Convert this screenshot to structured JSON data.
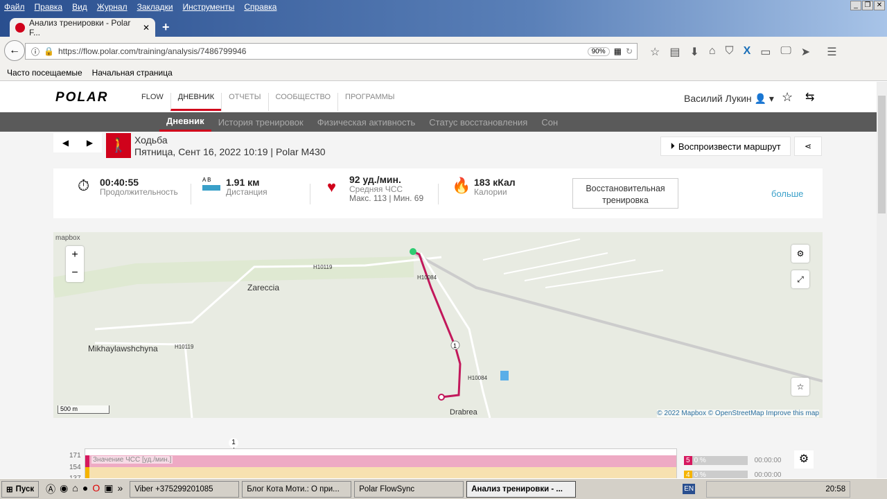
{
  "browser": {
    "menu": [
      "Файл",
      "Правка",
      "Вид",
      "Журнал",
      "Закладки",
      "Инструменты",
      "Справка"
    ],
    "tab_title": "Анализ тренировки - Polar F...",
    "url": "https://flow.polar.com/training/analysis/7486799946",
    "zoom": "90%",
    "bookmarks": [
      "Часто посещаемые",
      "Начальная страница"
    ]
  },
  "header": {
    "logo": "POLAR",
    "nav": [
      "FLOW",
      "ДНЕВНИК",
      "ОТЧЕТЫ",
      "СООБЩЕСТВО",
      "ПРОГРАММЫ"
    ],
    "user": "Василий Лукин"
  },
  "subnav": [
    "Дневник",
    "История тренировок",
    "Физическая активность",
    "Статус восстановления",
    "Сон"
  ],
  "session": {
    "sport": "Ходьба",
    "date": "Пятница, Сент 16, 2022 10:19 | Polar M430",
    "replay": "Воспроизвести маршрут"
  },
  "summary": {
    "duration": "00:40:55",
    "duration_label": "Продолжительность",
    "ab": "A   B",
    "distance": "1.91 км",
    "distance_label": "Дистанция",
    "hr": "92 уд./мин.",
    "hr_label": "Средняя ЧСС",
    "hr_minmax": "Макс. 113  |  Мин. 69",
    "calories": "183 кКал",
    "calories_label": "Калории",
    "benefit": "Восстановительная тренировка",
    "more": "больше"
  },
  "map": {
    "brand": "mapbox",
    "labels": [
      "Zareccia",
      "Mikhaylawshchyna",
      "H10119",
      "H10119",
      "H10084",
      "H10084",
      "Drabrea"
    ],
    "scale": "500 m",
    "attribution": "© 2022 Mapbox © OpenStreetMap Improve this map",
    "zoom_in": "+",
    "zoom_out": "−",
    "marker": "1"
  },
  "chart": {
    "yticks": [
      "171",
      "154",
      "137"
    ],
    "series_label": "Значение ЧСС [уд./мин.]",
    "marker": "1",
    "zones": [
      {
        "zone": "5",
        "pct": "0 %",
        "time": "00:00:00",
        "color": "#d6195f"
      },
      {
        "zone": "4",
        "pct": "0 %",
        "time": "00:00:00",
        "color": "#f5b400"
      }
    ]
  },
  "taskbar": {
    "start": "Пуск",
    "items": [
      "Viber +375299201085",
      "Блог Кота Моти.: О при...",
      "Polar FlowSync",
      "Анализ тренировки - ..."
    ],
    "lang": "EN",
    "clock": "20:58"
  }
}
